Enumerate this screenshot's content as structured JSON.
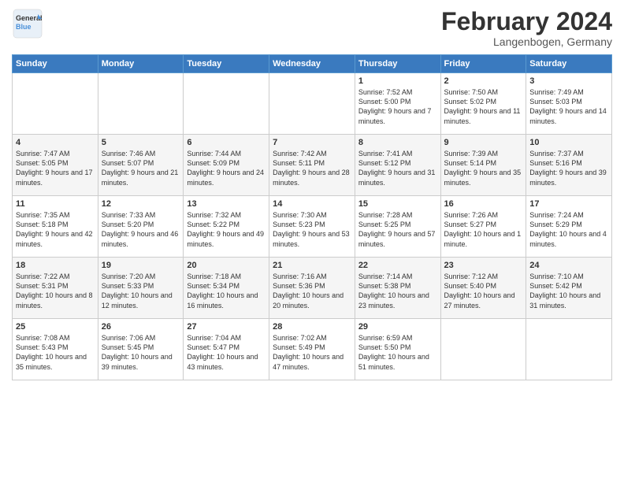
{
  "logo": {
    "line1": "General",
    "line2": "Blue"
  },
  "title": "February 2024",
  "subtitle": "Langenbogen, Germany",
  "weekdays": [
    "Sunday",
    "Monday",
    "Tuesday",
    "Wednesday",
    "Thursday",
    "Friday",
    "Saturday"
  ],
  "weeks": [
    [
      {
        "day": "",
        "info": ""
      },
      {
        "day": "",
        "info": ""
      },
      {
        "day": "",
        "info": ""
      },
      {
        "day": "",
        "info": ""
      },
      {
        "day": "1",
        "info": "Sunrise: 7:52 AM\nSunset: 5:00 PM\nDaylight: 9 hours\nand 7 minutes."
      },
      {
        "day": "2",
        "info": "Sunrise: 7:50 AM\nSunset: 5:02 PM\nDaylight: 9 hours\nand 11 minutes."
      },
      {
        "day": "3",
        "info": "Sunrise: 7:49 AM\nSunset: 5:03 PM\nDaylight: 9 hours\nand 14 minutes."
      }
    ],
    [
      {
        "day": "4",
        "info": "Sunrise: 7:47 AM\nSunset: 5:05 PM\nDaylight: 9 hours\nand 17 minutes."
      },
      {
        "day": "5",
        "info": "Sunrise: 7:46 AM\nSunset: 5:07 PM\nDaylight: 9 hours\nand 21 minutes."
      },
      {
        "day": "6",
        "info": "Sunrise: 7:44 AM\nSunset: 5:09 PM\nDaylight: 9 hours\nand 24 minutes."
      },
      {
        "day": "7",
        "info": "Sunrise: 7:42 AM\nSunset: 5:11 PM\nDaylight: 9 hours\nand 28 minutes."
      },
      {
        "day": "8",
        "info": "Sunrise: 7:41 AM\nSunset: 5:12 PM\nDaylight: 9 hours\nand 31 minutes."
      },
      {
        "day": "9",
        "info": "Sunrise: 7:39 AM\nSunset: 5:14 PM\nDaylight: 9 hours\nand 35 minutes."
      },
      {
        "day": "10",
        "info": "Sunrise: 7:37 AM\nSunset: 5:16 PM\nDaylight: 9 hours\nand 39 minutes."
      }
    ],
    [
      {
        "day": "11",
        "info": "Sunrise: 7:35 AM\nSunset: 5:18 PM\nDaylight: 9 hours\nand 42 minutes."
      },
      {
        "day": "12",
        "info": "Sunrise: 7:33 AM\nSunset: 5:20 PM\nDaylight: 9 hours\nand 46 minutes."
      },
      {
        "day": "13",
        "info": "Sunrise: 7:32 AM\nSunset: 5:22 PM\nDaylight: 9 hours\nand 49 minutes."
      },
      {
        "day": "14",
        "info": "Sunrise: 7:30 AM\nSunset: 5:23 PM\nDaylight: 9 hours\nand 53 minutes."
      },
      {
        "day": "15",
        "info": "Sunrise: 7:28 AM\nSunset: 5:25 PM\nDaylight: 9 hours\nand 57 minutes."
      },
      {
        "day": "16",
        "info": "Sunrise: 7:26 AM\nSunset: 5:27 PM\nDaylight: 10 hours\nand 1 minute."
      },
      {
        "day": "17",
        "info": "Sunrise: 7:24 AM\nSunset: 5:29 PM\nDaylight: 10 hours\nand 4 minutes."
      }
    ],
    [
      {
        "day": "18",
        "info": "Sunrise: 7:22 AM\nSunset: 5:31 PM\nDaylight: 10 hours\nand 8 minutes."
      },
      {
        "day": "19",
        "info": "Sunrise: 7:20 AM\nSunset: 5:33 PM\nDaylight: 10 hours\nand 12 minutes."
      },
      {
        "day": "20",
        "info": "Sunrise: 7:18 AM\nSunset: 5:34 PM\nDaylight: 10 hours\nand 16 minutes."
      },
      {
        "day": "21",
        "info": "Sunrise: 7:16 AM\nSunset: 5:36 PM\nDaylight: 10 hours\nand 20 minutes."
      },
      {
        "day": "22",
        "info": "Sunrise: 7:14 AM\nSunset: 5:38 PM\nDaylight: 10 hours\nand 23 minutes."
      },
      {
        "day": "23",
        "info": "Sunrise: 7:12 AM\nSunset: 5:40 PM\nDaylight: 10 hours\nand 27 minutes."
      },
      {
        "day": "24",
        "info": "Sunrise: 7:10 AM\nSunset: 5:42 PM\nDaylight: 10 hours\nand 31 minutes."
      }
    ],
    [
      {
        "day": "25",
        "info": "Sunrise: 7:08 AM\nSunset: 5:43 PM\nDaylight: 10 hours\nand 35 minutes."
      },
      {
        "day": "26",
        "info": "Sunrise: 7:06 AM\nSunset: 5:45 PM\nDaylight: 10 hours\nand 39 minutes."
      },
      {
        "day": "27",
        "info": "Sunrise: 7:04 AM\nSunset: 5:47 PM\nDaylight: 10 hours\nand 43 minutes."
      },
      {
        "day": "28",
        "info": "Sunrise: 7:02 AM\nSunset: 5:49 PM\nDaylight: 10 hours\nand 47 minutes."
      },
      {
        "day": "29",
        "info": "Sunrise: 6:59 AM\nSunset: 5:50 PM\nDaylight: 10 hours\nand 51 minutes."
      },
      {
        "day": "",
        "info": ""
      },
      {
        "day": "",
        "info": ""
      }
    ]
  ]
}
